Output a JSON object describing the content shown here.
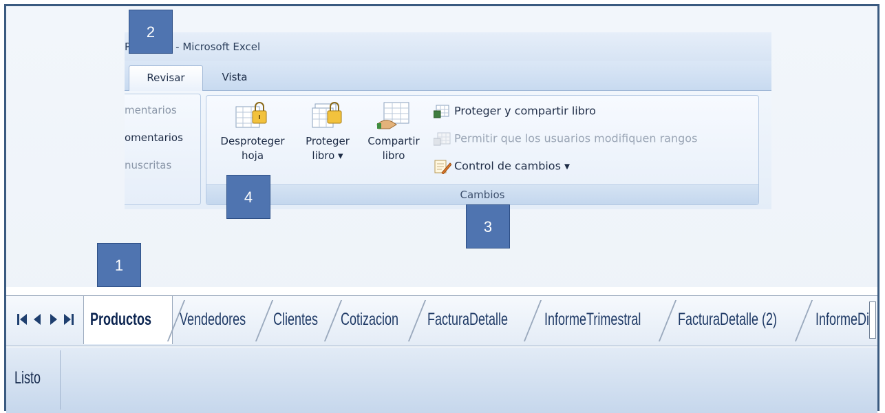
{
  "window": {
    "title": "Practica1 - Microsoft Excel"
  },
  "ribbon": {
    "tabs": [
      {
        "label": "Revisar",
        "active": true
      },
      {
        "label": "Vista",
        "active": false
      }
    ],
    "comentarios_group": {
      "items": [
        "mentarios",
        "omentarios",
        "nuscritas"
      ]
    },
    "cambios_group": {
      "label": "Cambios",
      "buttons": {
        "desproteger_hoja": "Desproteger\nhoja",
        "proteger_libro": "Proteger\nlibro ▾",
        "compartir_libro": "Compartir\nlibro"
      },
      "small_buttons": {
        "proteger_compartir": "Proteger y compartir libro",
        "permitir_rangos": "Permitir que los usuarios modifiquen rangos",
        "control_cambios": "Control de cambios ▾"
      }
    }
  },
  "callouts": [
    "1",
    "2",
    "3",
    "4"
  ],
  "sheet_tabs": {
    "nav_arrows": "◀ ◀ ▶ ▶",
    "tabs": [
      {
        "label": "Productos",
        "active": true
      },
      {
        "label": "Vendedores",
        "active": false
      },
      {
        "label": "Clientes",
        "active": false
      },
      {
        "label": "Cotizacion",
        "active": false
      },
      {
        "label": "FacturaDetalle",
        "active": false
      },
      {
        "label": "InformeTrimestral",
        "active": false
      },
      {
        "label": "FacturaDetalle (2)",
        "active": false
      },
      {
        "label": "InformeDin",
        "active": false
      }
    ]
  },
  "status_bar": {
    "text": "Listo"
  },
  "colors": {
    "callout_fill": "#4f74b0",
    "frame_border": "#3a5a80",
    "ribbon_blue": "#c8daf0"
  }
}
